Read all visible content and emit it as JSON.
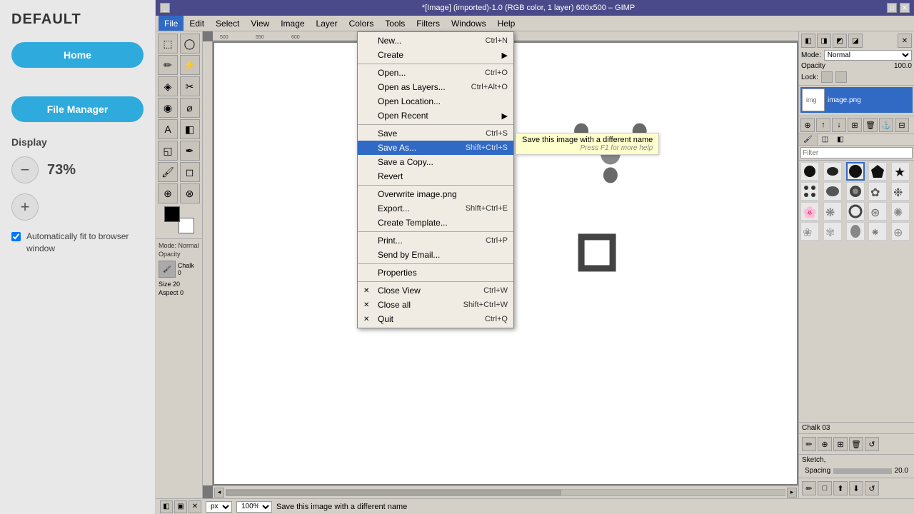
{
  "sidebar": {
    "title": "DEFAULT",
    "home_label": "Home",
    "filemgr_label": "File Manager",
    "display_label": "Display",
    "zoom_percent": "73%",
    "auto_fit_label": "Automatically fit to browser window"
  },
  "gimp": {
    "titlebar": "*[Image] (imported)-1.0 (RGB color, 1 layer) 600x500 – GIMP",
    "menubar": [
      "File",
      "Edit",
      "Select",
      "View",
      "Image",
      "Layer",
      "Colors",
      "Tools",
      "Filters",
      "Windows",
      "Help"
    ],
    "file_menu": [
      {
        "label": "New...",
        "shortcut": "Ctrl+N",
        "type": "item"
      },
      {
        "label": "Create",
        "shortcut": "",
        "type": "submenu"
      },
      {
        "label": "",
        "type": "separator"
      },
      {
        "label": "Open...",
        "shortcut": "Ctrl+O",
        "type": "item"
      },
      {
        "label": "Open as Layers...",
        "shortcut": "Ctrl+Alt+O",
        "type": "item"
      },
      {
        "label": "Open Location...",
        "shortcut": "",
        "type": "item"
      },
      {
        "label": "Open Recent",
        "shortcut": "",
        "type": "submenu"
      },
      {
        "label": "",
        "type": "separator"
      },
      {
        "label": "Save",
        "shortcut": "Ctrl+S",
        "type": "item"
      },
      {
        "label": "Save As...",
        "shortcut": "Shift+Ctrl+S",
        "type": "item",
        "highlighted": true
      },
      {
        "label": "Save a Copy...",
        "shortcut": "",
        "type": "item"
      },
      {
        "label": "Revert",
        "shortcut": "",
        "type": "item"
      },
      {
        "label": "",
        "type": "separator"
      },
      {
        "label": "Overwrite image.png",
        "shortcut": "",
        "type": "item"
      },
      {
        "label": "Export...",
        "shortcut": "Shift+Ctrl+E",
        "type": "item"
      },
      {
        "label": "Create Template...",
        "shortcut": "",
        "type": "item"
      },
      {
        "label": "",
        "type": "separator"
      },
      {
        "label": "Print...",
        "shortcut": "Ctrl+P",
        "type": "item"
      },
      {
        "label": "Send by Email...",
        "shortcut": "",
        "type": "item"
      },
      {
        "label": "",
        "type": "separator"
      },
      {
        "label": "Properties",
        "shortcut": "",
        "type": "item"
      },
      {
        "label": "",
        "type": "separator"
      },
      {
        "label": "Close View",
        "shortcut": "Ctrl+W",
        "type": "item",
        "has_x": true
      },
      {
        "label": "Close all",
        "shortcut": "Shift+Ctrl+W",
        "type": "item",
        "has_x": true
      },
      {
        "label": "Quit",
        "shortcut": "Ctrl+Q",
        "type": "item",
        "has_x": true
      }
    ],
    "saveas_tooltip": "Save this image with a different name",
    "press_f1": "Press F1 for more help",
    "status_msg": "Save this image with a different name",
    "zoom": "100%",
    "unit": "px",
    "mode": "Normal",
    "opacity": "100.0",
    "brush_name": "Chalk 03",
    "spacing_label": "Spacing",
    "spacing_val": "20.0",
    "filter_placeholder": "Filter"
  },
  "colors": {
    "sidebar_bg": "#e8e8e8",
    "sidebar_btn": "#2eaadc",
    "gimp_title": "#4a4a8a",
    "menu_highlight": "#316ac5",
    "menu_bg": "#f0ece4",
    "canvas_bg": "#808080"
  }
}
